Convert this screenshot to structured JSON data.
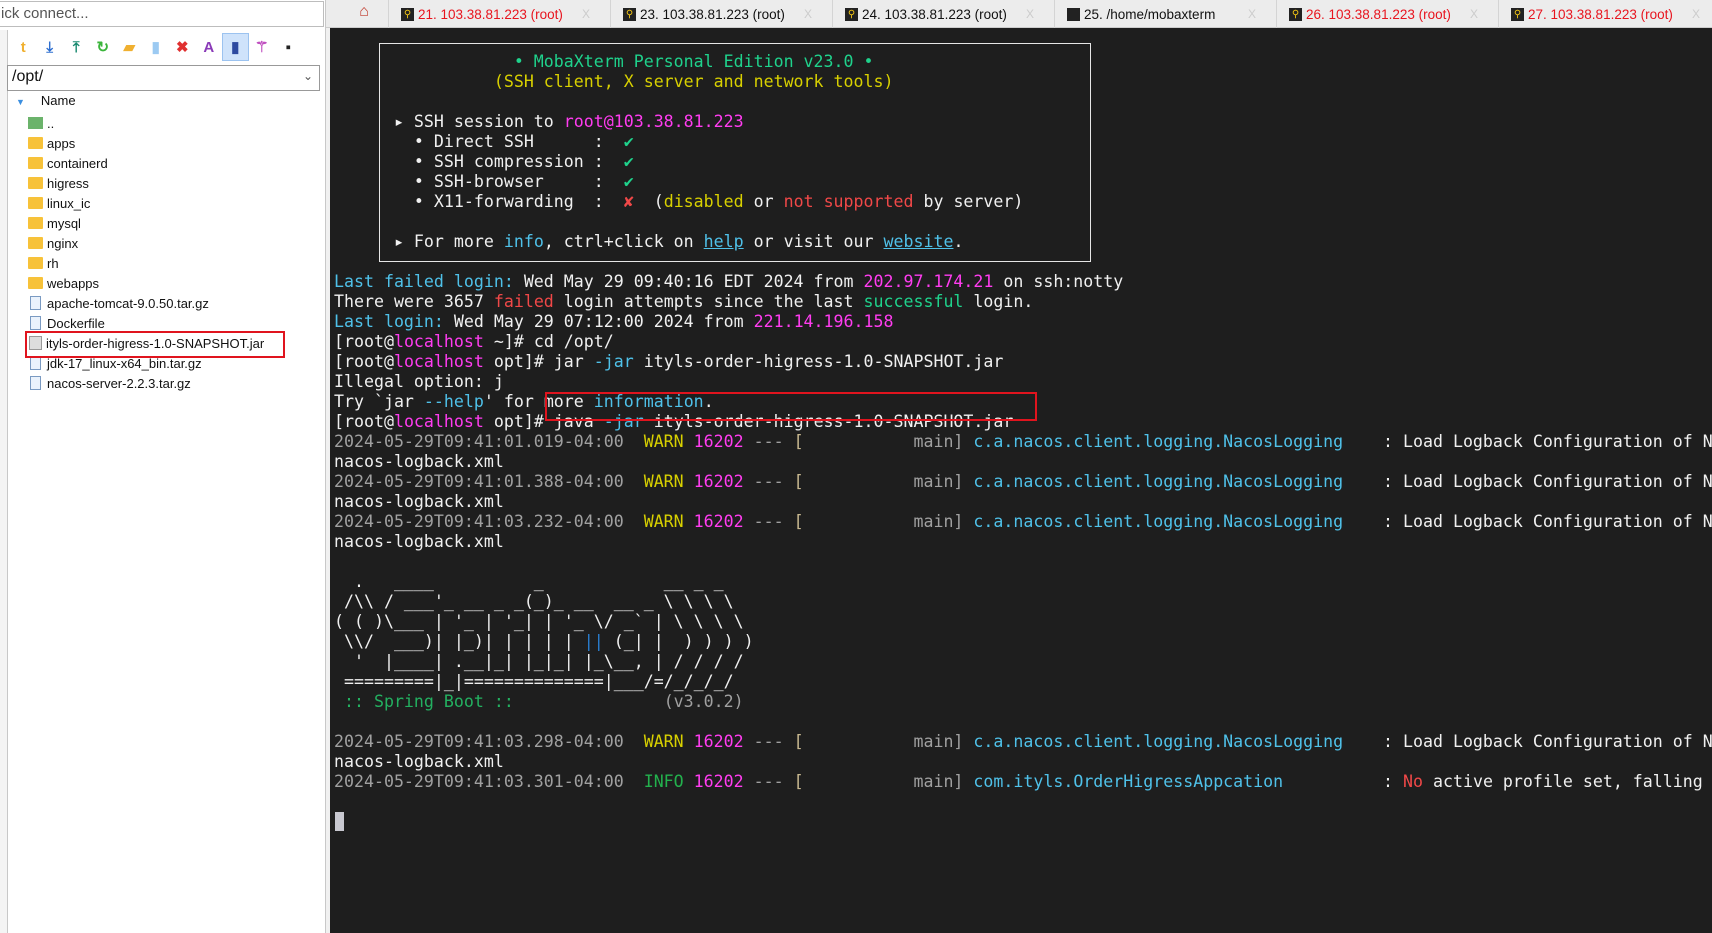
{
  "quick_connect": {
    "placeholder": "ick connect..."
  },
  "toolbar": {
    "icons": [
      "parent-folder-icon",
      "download-icon",
      "upload-icon",
      "refresh-icon",
      "new-folder-icon",
      "new-file-icon",
      "delete-icon",
      "rename-icon",
      "show-hidden-icon",
      "magic-wand-icon",
      "terminal-icon"
    ]
  },
  "path": {
    "value": "/opt/"
  },
  "file_list": {
    "header": "Name",
    "items": [
      {
        "name": "..",
        "type": "up"
      },
      {
        "name": "apps",
        "type": "folder"
      },
      {
        "name": "containerd",
        "type": "folder"
      },
      {
        "name": "higress",
        "type": "folder"
      },
      {
        "name": "linux_ic",
        "type": "folder"
      },
      {
        "name": "mysql",
        "type": "folder"
      },
      {
        "name": "nginx",
        "type": "folder"
      },
      {
        "name": "rh",
        "type": "folder"
      },
      {
        "name": "webapps",
        "type": "folder"
      },
      {
        "name": "apache-tomcat-9.0.50.tar.gz",
        "type": "file"
      },
      {
        "name": "Dockerfile",
        "type": "file"
      },
      {
        "name": "ityls-order-higress-1.0-SNAPSHOT.jar",
        "type": "jar",
        "highlighted": true
      },
      {
        "name": "jdk-17_linux-x64_bin.tar.gz",
        "type": "file"
      },
      {
        "name": "nacos-server-2.2.3.tar.gz",
        "type": "file"
      }
    ]
  },
  "tabs": [
    {
      "label": "21. 103.38.81.223 (root)",
      "color": "#e8141e"
    },
    {
      "label": "23. 103.38.81.223 (root)",
      "color": "#111111"
    },
    {
      "label": "24. 103.38.81.223 (root)",
      "color": "#111111"
    },
    {
      "label": "25. /home/mobaxterm",
      "color": "#111111"
    },
    {
      "label": "26. 103.38.81.223 (root)",
      "color": "#e8141e"
    },
    {
      "label": "27. 103.38.81.223 (root)",
      "color": "#e8141e"
    }
  ],
  "tab_close": "X",
  "colors": {
    "w": "#f0f0f0",
    "g": "#1fd28c",
    "y": "#d8d000",
    "m": "#ff3cf0",
    "c": "#4fc1e9",
    "r": "#f04848",
    "gr": "#a0a0a0",
    "tan": "#c8b890",
    "sg": "#23b060",
    "in": "#23b14d",
    "bl": "#2a7fd0"
  },
  "terminal": {
    "lines": [
      [
        [
          "                  • MobaXterm Personal Edition v23.0 •",
          "g"
        ]
      ],
      [
        [
          "                (SSH client, X server and network tools)",
          "y"
        ]
      ],
      [],
      [
        [
          "      ▸ SSH session to ",
          "w"
        ],
        [
          "root@103.38.81.223",
          "m"
        ]
      ],
      [
        [
          "        • Direct SSH      :  ",
          "w"
        ],
        [
          "✔",
          "g"
        ]
      ],
      [
        [
          "        • SSH compression :  ",
          "w"
        ],
        [
          "✔",
          "g"
        ]
      ],
      [
        [
          "        • SSH-browser     :  ",
          "w"
        ],
        [
          "✔",
          "g"
        ]
      ],
      [
        [
          "        • X11-forwarding  :  ",
          "w"
        ],
        [
          "✘",
          "r"
        ],
        [
          "  (",
          "w"
        ],
        [
          "disabled",
          "y"
        ],
        [
          " or ",
          "w"
        ],
        [
          "not supported",
          "r"
        ],
        [
          " by server)",
          "w"
        ]
      ],
      [],
      [
        [
          "      ▸ For more ",
          "w"
        ],
        [
          "info",
          "c"
        ],
        [
          ", ctrl+click on ",
          "w"
        ],
        [
          "help",
          "cu"
        ],
        [
          " or visit our ",
          "w"
        ],
        [
          "website",
          "cu"
        ],
        [
          ".",
          "w"
        ]
      ],
      [],
      [
        [
          "Last failed login:",
          "c"
        ],
        [
          " Wed May 29 09:40:16 EDT 2024 from ",
          "w"
        ],
        [
          "202.97.174.21",
          "m"
        ],
        [
          " on ssh:notty",
          "w"
        ]
      ],
      [
        [
          "There were 3657 ",
          "w"
        ],
        [
          "failed",
          "r"
        ],
        [
          " login attempts since the last ",
          "w"
        ],
        [
          "successful",
          "g"
        ],
        [
          " login.",
          "w"
        ]
      ],
      [
        [
          "Last login:",
          "c"
        ],
        [
          " Wed May 29 07:12:00 2024 from ",
          "w"
        ],
        [
          "221.14.196.158",
          "m"
        ]
      ],
      [
        [
          "[root@",
          "w"
        ],
        [
          "localhost",
          "m"
        ],
        [
          " ~]# cd /opt/",
          "w"
        ]
      ],
      [
        [
          "[root@",
          "w"
        ],
        [
          "localhost",
          "m"
        ],
        [
          " opt]# jar ",
          "w"
        ],
        [
          "-jar",
          "c"
        ],
        [
          " ityls-order-higress-1.0-SNAPSHOT.jar",
          "w"
        ]
      ],
      [
        [
          "Illegal option: j",
          "w"
        ]
      ],
      [
        [
          "Try `jar ",
          "w"
        ],
        [
          "--help",
          "c"
        ],
        [
          "' for more ",
          "w"
        ],
        [
          "information",
          "c"
        ],
        [
          ".",
          "w"
        ]
      ],
      [
        [
          "[root@",
          "w"
        ],
        [
          "localhost",
          "m"
        ],
        [
          " opt]# java ",
          "w"
        ],
        [
          "-jar",
          "c"
        ],
        [
          " ityls-order-higress-1.0-SNAPSHOT.jar",
          "w"
        ]
      ],
      [
        [
          "2024-05-29T09:41:01.019-04:00  ",
          "gr"
        ],
        [
          "WARN",
          "y"
        ],
        [
          " 16202",
          "m"
        ],
        [
          " --- ",
          "gr"
        ],
        [
          "[",
          "tan"
        ],
        [
          "           main] ",
          "gr"
        ],
        [
          "c.a.nacos.client.logging.NacosLogging",
          "c"
        ],
        [
          "    : Load Logback Configuration of N",
          "w"
        ]
      ],
      [
        [
          "nacos-logback.xml",
          "w"
        ]
      ],
      [
        [
          "2024-05-29T09:41:01.388-04:00  ",
          "gr"
        ],
        [
          "WARN",
          "y"
        ],
        [
          " 16202",
          "m"
        ],
        [
          " --- ",
          "gr"
        ],
        [
          "[",
          "tan"
        ],
        [
          "           main] ",
          "gr"
        ],
        [
          "c.a.nacos.client.logging.NacosLogging",
          "c"
        ],
        [
          "    : Load Logback Configuration of N",
          "w"
        ]
      ],
      [
        [
          "nacos-logback.xml",
          "w"
        ]
      ],
      [
        [
          "2024-05-29T09:41:03.232-04:00  ",
          "gr"
        ],
        [
          "WARN",
          "y"
        ],
        [
          " 16202",
          "m"
        ],
        [
          " --- ",
          "gr"
        ],
        [
          "[",
          "tan"
        ],
        [
          "           main] ",
          "gr"
        ],
        [
          "c.a.nacos.client.logging.NacosLogging",
          "c"
        ],
        [
          "    : Load Logback Configuration of N",
          "w"
        ]
      ],
      [
        [
          "nacos-logback.xml",
          "w"
        ]
      ],
      [],
      [
        [
          "  .   ____          _            __ _ _",
          "w"
        ]
      ],
      [
        [
          " /\\\\ / ___'_ __ _ _(_)_ __  __ _ \\ \\ \\ \\",
          "w"
        ]
      ],
      [
        [
          "( ( )\\___ | '_ | '_| | '_ \\/ _` | \\ \\ \\ \\",
          "w"
        ]
      ],
      [
        [
          " \\\\/  ___)| |_)| | | | | ",
          "w"
        ],
        [
          "||",
          "bl"
        ],
        [
          " (_| |  ) ) ) )",
          "w"
        ]
      ],
      [
        [
          "  '  |____| .__|_| |_|_| |_\\__, | / / / /",
          "w"
        ]
      ],
      [
        [
          " =========|_|==============|___/=/_/_/_/",
          "w"
        ]
      ],
      [
        [
          " :: Spring Boot :: ",
          "sg"
        ],
        [
          "              (v3.0.2)",
          "gr"
        ]
      ],
      [],
      [
        [
          "2024-05-29T09:41:03.298-04:00  ",
          "gr"
        ],
        [
          "WARN",
          "y"
        ],
        [
          " 16202",
          "m"
        ],
        [
          " --- ",
          "gr"
        ],
        [
          "[",
          "tan"
        ],
        [
          "           main] ",
          "gr"
        ],
        [
          "c.a.nacos.client.logging.NacosLogging",
          "c"
        ],
        [
          "    : Load Logback Configuration of N",
          "w"
        ]
      ],
      [
        [
          "nacos-logback.xml",
          "w"
        ]
      ],
      [
        [
          "2024-05-29T09:41:03.301-04:00  ",
          "gr"
        ],
        [
          "INFO",
          "in"
        ],
        [
          " 16202",
          "m"
        ],
        [
          " --- ",
          "gr"
        ],
        [
          "[",
          "tan"
        ],
        [
          "           main] ",
          "gr"
        ],
        [
          "com.ityls.OrderHigressAppcation",
          "c"
        ],
        [
          "          : ",
          "w"
        ],
        [
          "No",
          "r"
        ],
        [
          " active profile set, falling",
          "w"
        ]
      ]
    ]
  }
}
